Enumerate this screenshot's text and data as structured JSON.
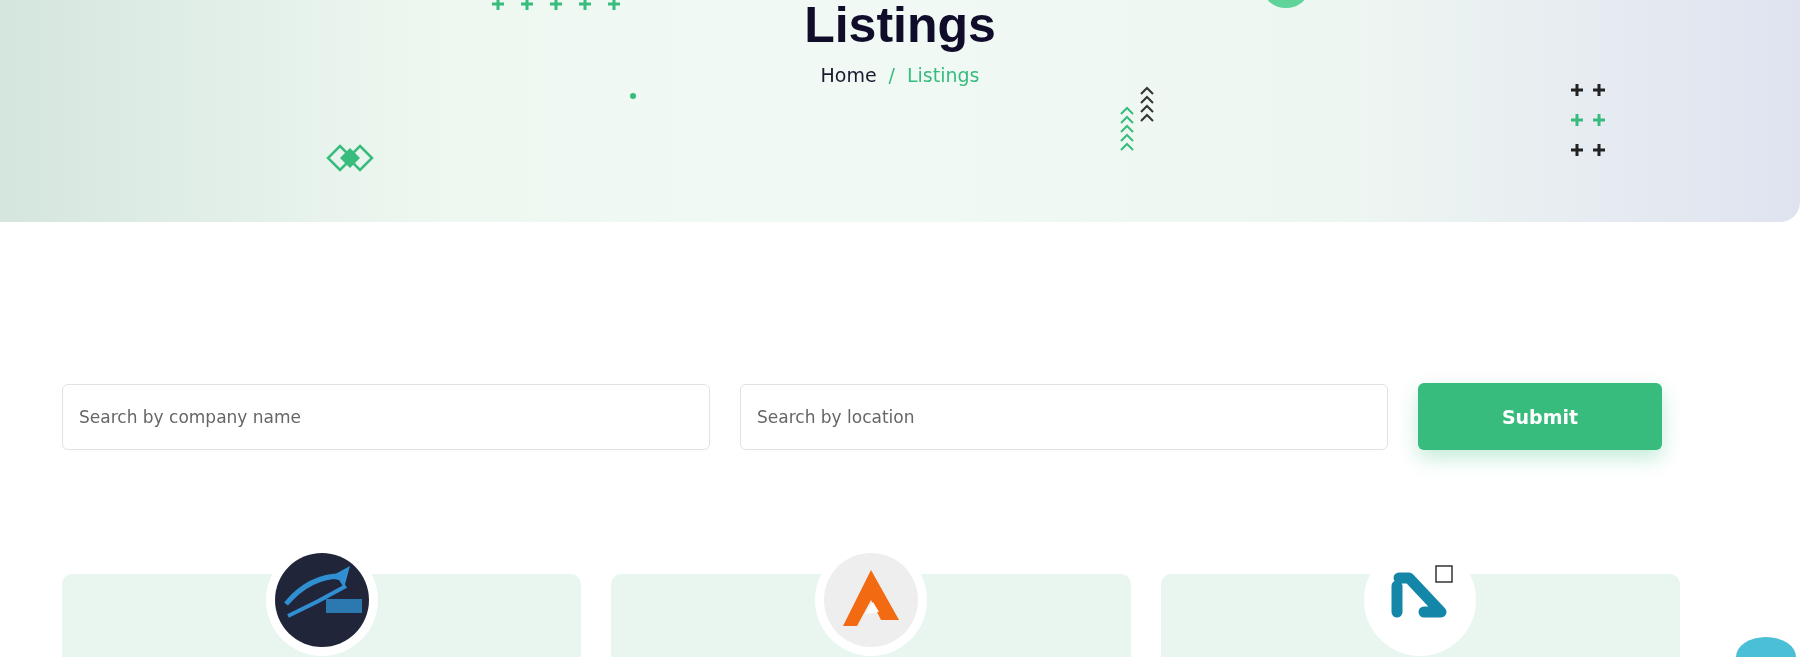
{
  "banner": {
    "title": "Listings",
    "breadcrumb": {
      "separator": "/",
      "items": [
        {
          "label": "Home",
          "current": false
        },
        {
          "label": "Listings",
          "current": true
        }
      ]
    }
  },
  "search": {
    "fields": [
      {
        "placeholder": "Search by company name"
      },
      {
        "placeholder": "Search by location"
      }
    ],
    "submit": "Submit"
  },
  "cards": [
    {
      "kind": "plane"
    },
    {
      "kind": "peak"
    },
    {
      "kind": "angle"
    }
  ]
}
